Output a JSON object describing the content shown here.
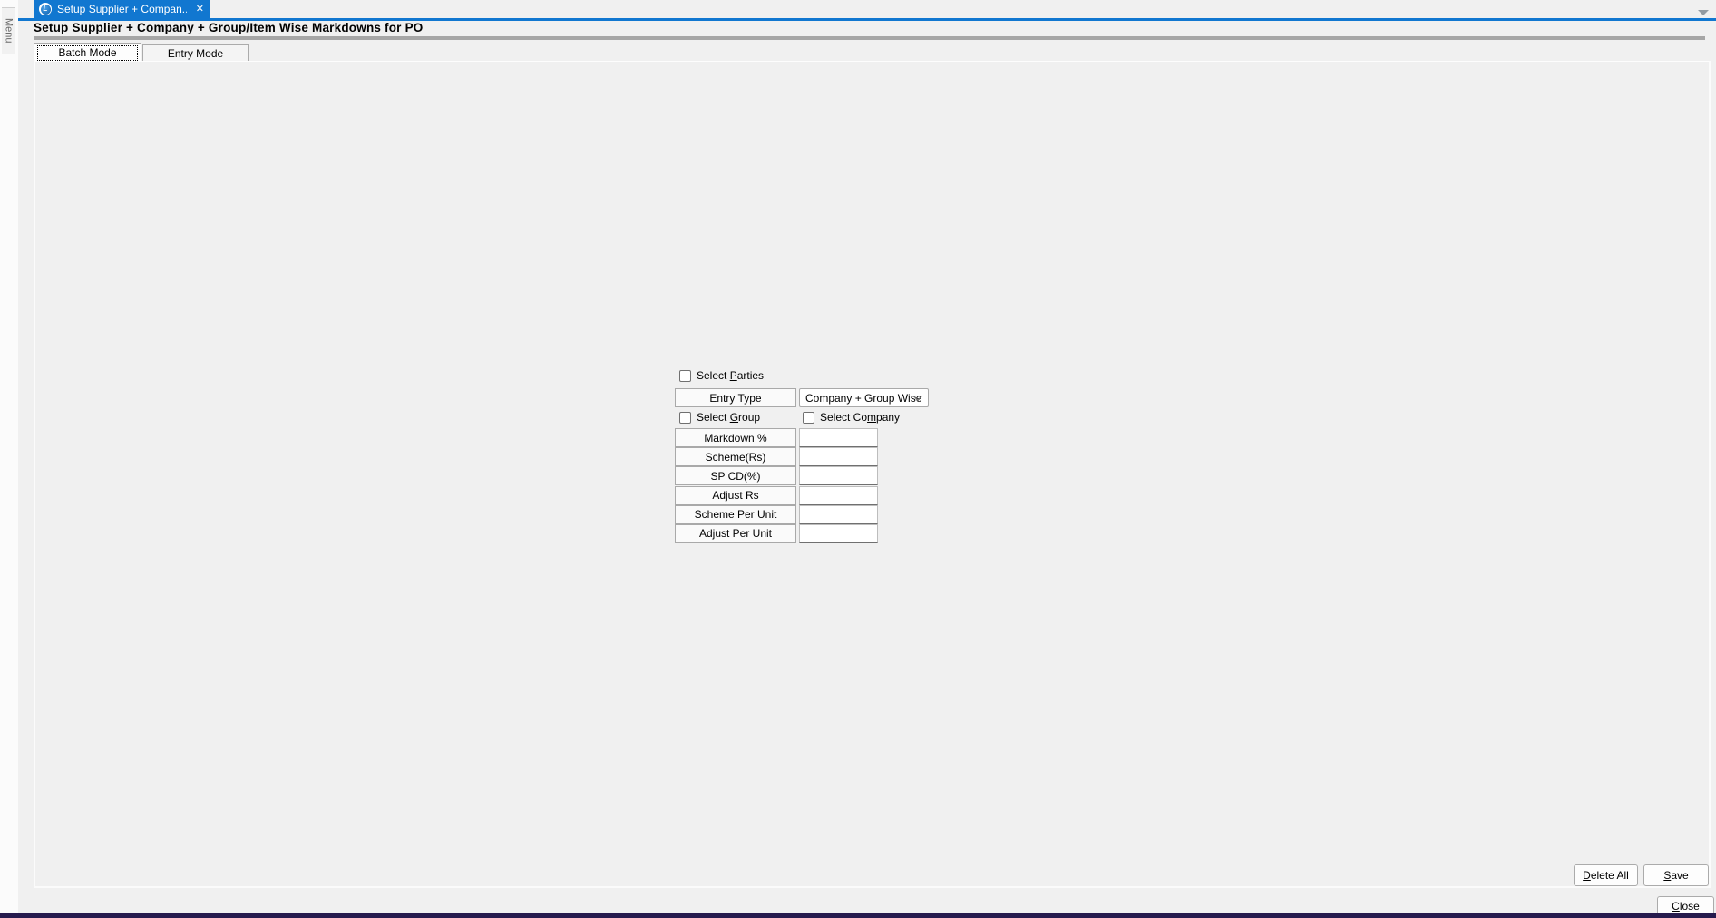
{
  "window": {
    "menu_strip_label": "Menu",
    "doc_tab": {
      "title": "Setup Supplier + Compan...",
      "logo_letter": "L",
      "close_glyph": "✕"
    },
    "page_title": "Setup Supplier + Company + Group/Item Wise Markdowns for PO",
    "mode_tabs": [
      {
        "label": "Batch Mode",
        "active": true
      },
      {
        "label": "Entry Mode",
        "active": false
      }
    ]
  },
  "form": {
    "select_parties": {
      "pre": "Select ",
      "m": "P",
      "post": "arties",
      "checked": false
    },
    "entry_type_label": "Entry Type",
    "entry_type_value": "Company + Group Wise",
    "select_group": {
      "pre": "Select ",
      "m": "G",
      "post": "roup",
      "checked": false
    },
    "select_company": {
      "pre": "Select Co",
      "m": "m",
      "post": "pany",
      "checked": false
    },
    "fields": [
      {
        "label": "Markdown %",
        "value": ""
      },
      {
        "label": "Scheme(Rs)",
        "value": ""
      },
      {
        "label": "SP CD(%)",
        "value": ""
      },
      {
        "label": "Adjust Rs",
        "value": ""
      },
      {
        "label": "Scheme Per Unit",
        "value": ""
      },
      {
        "label": "Adjust Per Unit",
        "value": ""
      }
    ]
  },
  "buttons": {
    "delete_all": {
      "m": "D",
      "post": "elete All"
    },
    "save": {
      "m": "S",
      "post": "ave"
    },
    "close": {
      "m": "C",
      "post": "lose"
    }
  },
  "colors": {
    "accent_blue": "#1177d0",
    "bottom_border_purple": "#261a4d",
    "title_rule_gray": "#a6a6a6"
  }
}
